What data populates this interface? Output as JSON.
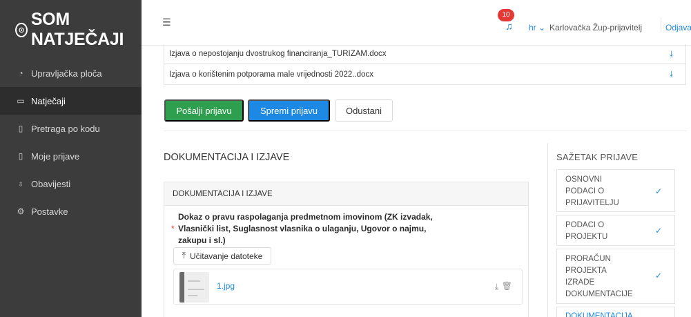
{
  "sidebar": {
    "logo_text": "SOM NATJEČAJI",
    "items": [
      {
        "label": "Upravljačka ploča",
        "icon": "dashboard-icon"
      },
      {
        "label": "Natječaji",
        "icon": "folder-icon",
        "active": true
      },
      {
        "label": "Pretraga po kodu",
        "icon": "document-search-icon"
      },
      {
        "label": "Moje prijave",
        "icon": "document-icon"
      },
      {
        "label": "Obavijesti",
        "icon": "bell-icon"
      },
      {
        "label": "Postavke",
        "icon": "gear-icon"
      }
    ]
  },
  "topbar": {
    "notification_count": "10",
    "language": "hr",
    "user": "Karlovačka Žup-prijavitelj",
    "logout": "Odjava"
  },
  "files": [
    {
      "name": "Izjava o nepostojanju dvostrukog financiranja_TURIZAM.docx"
    },
    {
      "name": "Izjava o korištenim potporama male vrijednosti 2022..docx"
    }
  ],
  "actions": {
    "send": "Pošalji prijavu",
    "save": "Spremi prijavu",
    "cancel": "Odustani"
  },
  "section": {
    "title": "DOKUMENTACIJA I IZJAVE",
    "card_title": "DOKUMENTACIJA I IZJAVE",
    "requirement_lines": [
      "Dokaz o pravu raspolaganja predmetnom imovinom (ZK izvadak,",
      "Vlasnički list, Suglasnost vlasnika o ulaganju, Ugovor o najmu,",
      "zakupu i sl.)"
    ],
    "required_marker": "*",
    "upload_label": "Učitavanje datoteke",
    "uploaded_file": "1.jpg"
  },
  "summary": {
    "title": "SAŽETAK PRIJAVE",
    "items": [
      {
        "lines": [
          "OSNOVNI",
          "PODACI O",
          "PRIJAVITELJU"
        ],
        "done": true
      },
      {
        "lines": [
          "PODACI O",
          "PROJEKTU"
        ],
        "done": true
      },
      {
        "lines": [
          "PRORAČUN",
          "PROJEKTA",
          "IZRADE",
          "DOKUMENTACIJE"
        ],
        "done": true
      },
      {
        "lines": [
          "DOKUMENTACIJA"
        ],
        "done": false
      }
    ]
  },
  "colors": {
    "sidebar_bg": "#3c3c3c",
    "primary": "#1e88e5",
    "success": "#2e9e4f",
    "danger": "#e53935"
  }
}
